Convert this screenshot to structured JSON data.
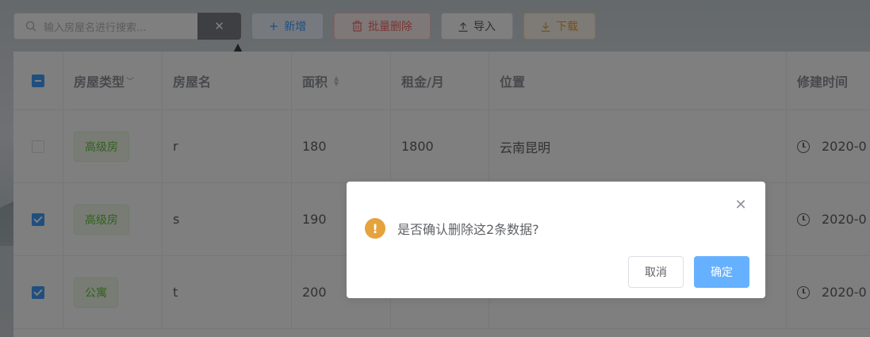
{
  "toolbar": {
    "search_placeholder": "输入房屋名进行搜索...",
    "clear_symbol": "✕",
    "add_label": "新增",
    "batch_delete_label": "批量删除",
    "import_label": "导入",
    "download_label": "下载"
  },
  "table": {
    "headers": {
      "type": "房屋类型",
      "name": "房屋名",
      "area": "面积",
      "rent": "租金/月",
      "location": "位置",
      "built_time": "修建时间"
    },
    "rows": [
      {
        "checked": false,
        "type": "高级房",
        "name": "r",
        "area": "180",
        "rent": "1800",
        "location": "云南昆明",
        "built_time": "2020-0"
      },
      {
        "checked": true,
        "type": "高级房",
        "name": "s",
        "area": "190",
        "rent": "",
        "location": "",
        "built_time": "2020-0"
      },
      {
        "checked": true,
        "type": "公寓",
        "name": "t",
        "area": "200",
        "rent": "",
        "location": "",
        "built_time": "2020-0"
      }
    ]
  },
  "dialog": {
    "close_symbol": "✕",
    "warning_symbol": "!",
    "message": "是否确认删除这2条数据?",
    "cancel_label": "取消",
    "confirm_label": "确定"
  }
}
